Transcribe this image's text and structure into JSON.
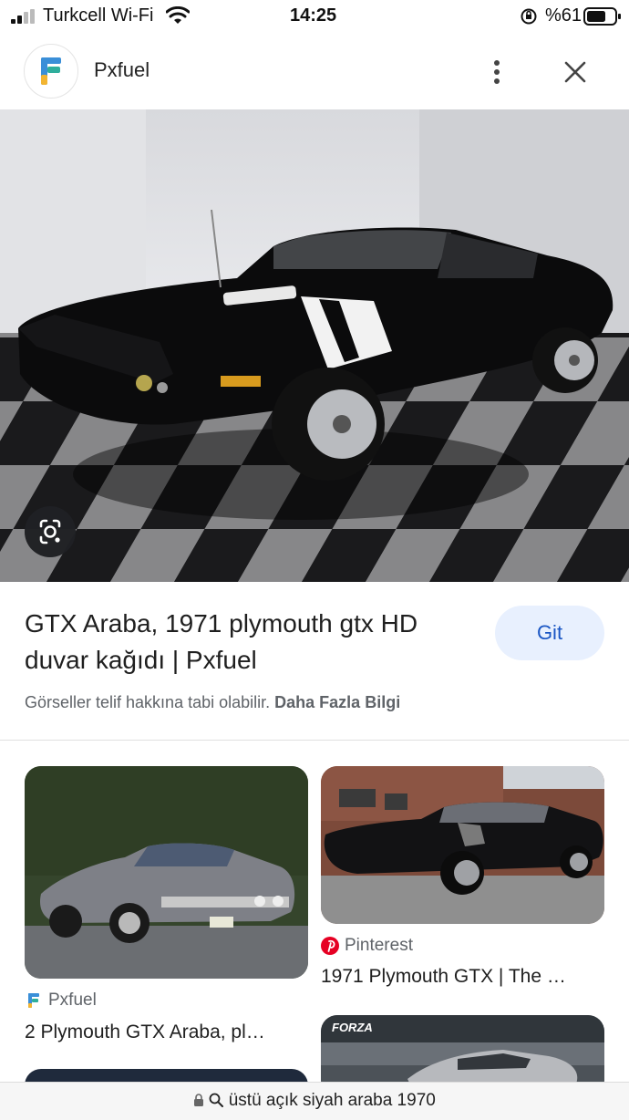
{
  "status": {
    "carrier": "Turkcell Wi-Fi",
    "time": "14:25",
    "battery_pct": "%61"
  },
  "header": {
    "site_name": "Pxfuel"
  },
  "result": {
    "title": "GTX Araba, 1971 plymouth gtx HD duvar kağıdı | Pxfuel",
    "visit_label": "Git",
    "copyright_text": "Görseller telif hakkına tabi olabilir.",
    "more_info_label": "Daha Fazla Bilgi"
  },
  "related": [
    {
      "source": "Pxfuel",
      "title": "2 Plymouth GTX Araba, pl…",
      "icon": "pxfuel-icon"
    },
    {
      "source": "Pinterest",
      "title": "1971 Plymouth GTX | The …",
      "icon": "pinterest-icon"
    }
  ],
  "partial_card_text": "FORZA",
  "url_bar": {
    "query": "üstü açık siyah araba 1970"
  },
  "colors": {
    "accent": "#1a56c4",
    "visit_bg": "#e8f0fe",
    "pinterest": "#e60023"
  }
}
